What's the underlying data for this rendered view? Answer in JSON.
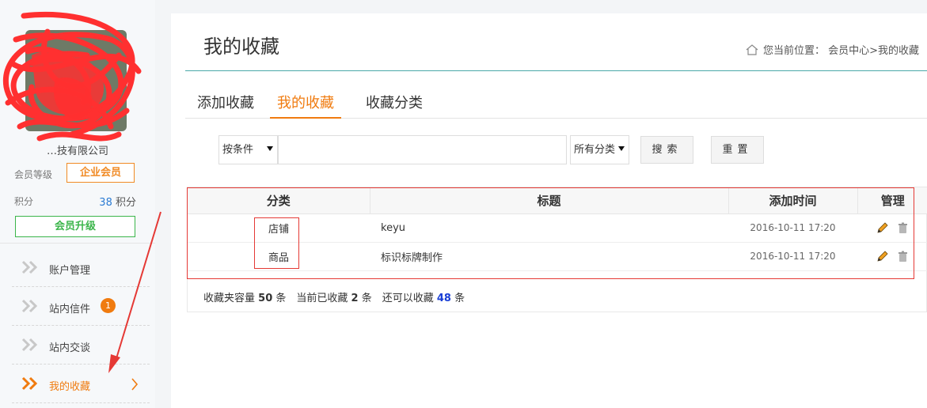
{
  "sidebar": {
    "company_name": "…技有限公司",
    "member_level_label": "会员等级",
    "member_level_value": "企业会员",
    "points_label": "积分",
    "points_value": "38",
    "points_unit": "积分",
    "upgrade_label": "会员升级",
    "menu": [
      {
        "label": "账户管理"
      },
      {
        "label": "站内信件",
        "count": "1"
      },
      {
        "label": "站内交谈"
      },
      {
        "label": "我的收藏"
      }
    ]
  },
  "header": {
    "title": "我的收藏",
    "breadcrumb_prefix": "您当前位置：",
    "breadcrumb_path": "会员中心>我的收藏"
  },
  "tabs": [
    {
      "label": "添加收藏"
    },
    {
      "label": "我的收藏"
    },
    {
      "label": "收藏分类"
    }
  ],
  "filter": {
    "condition_value": "按条件",
    "keyword_value": "",
    "category_value": "所有分类",
    "search_label": "搜索",
    "reset_label": "重置"
  },
  "table": {
    "headers": [
      "分类",
      "标题",
      "添加时间",
      "管理"
    ],
    "rows": [
      {
        "category": "店铺",
        "title": "keyu",
        "time": "2016-10-11 17:20"
      },
      {
        "category": "商品",
        "title": "标识标牌制作",
        "time": "2016-10-11 17:20"
      }
    ]
  },
  "summary": {
    "t1": "收藏夹容量",
    "capacity": "50",
    "t2": "条　当前已收藏",
    "used": "2",
    "t3": "条　还可以收藏",
    "remaining": "48",
    "t4": "条"
  },
  "colors": {
    "accent": "#f07b0f",
    "green": "#3bb54a",
    "annotation_red": "#e53935",
    "rule_teal": "#4aa9a8"
  }
}
